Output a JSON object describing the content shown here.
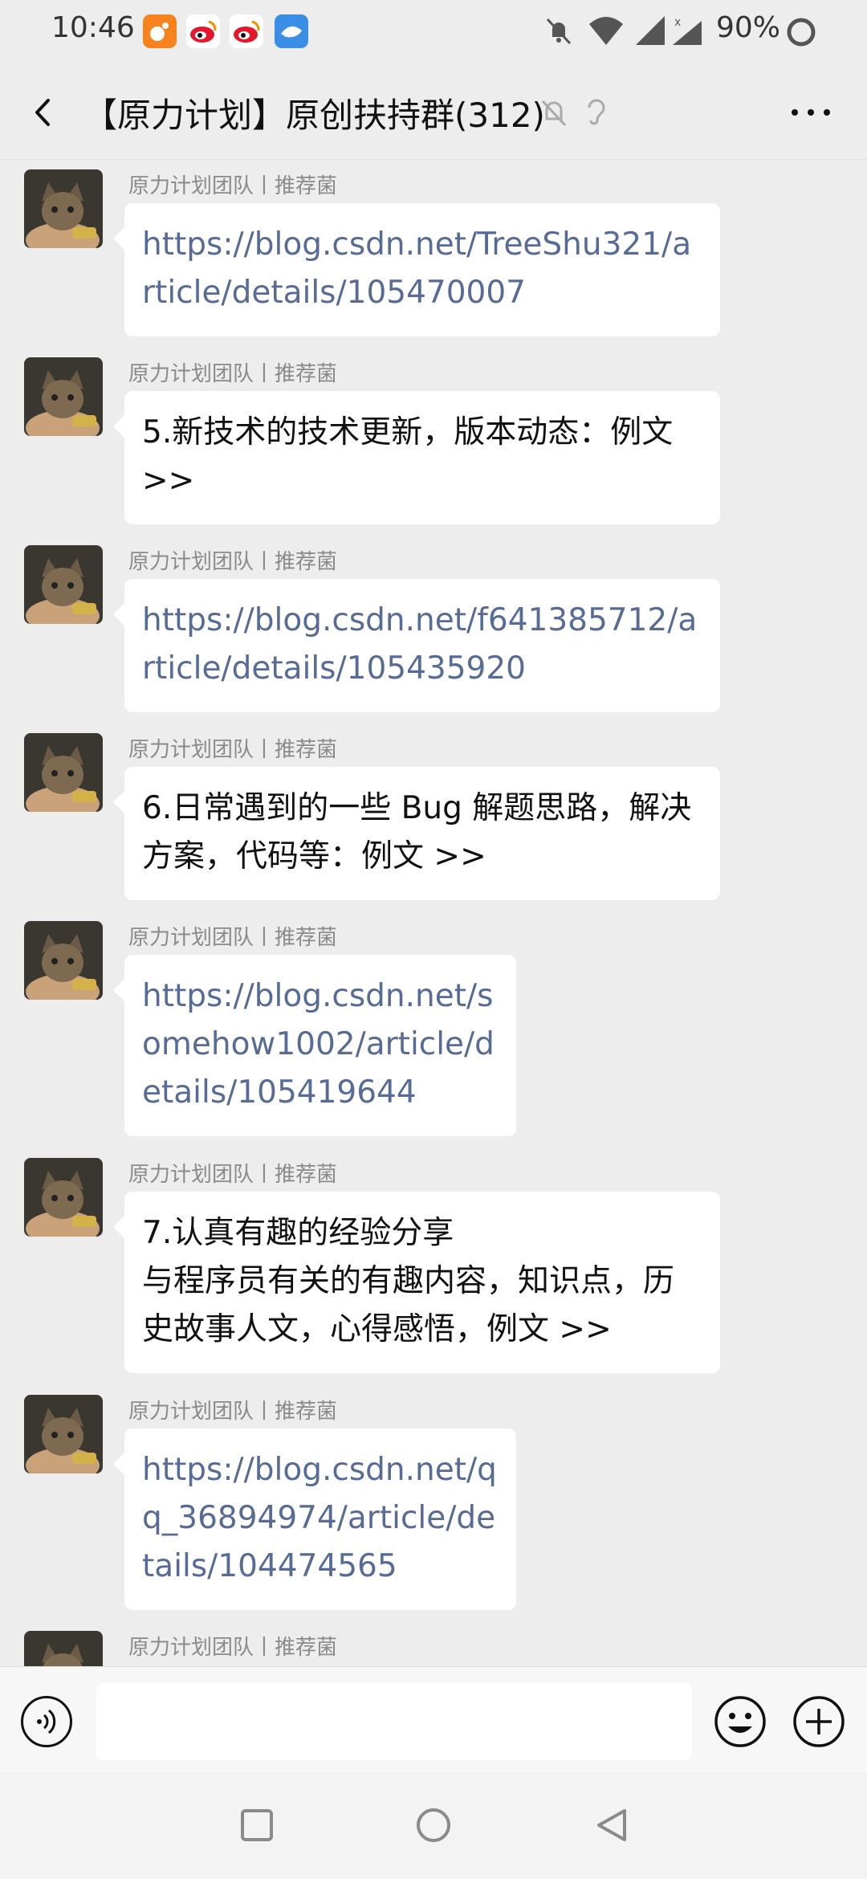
{
  "status_bar": {
    "time": "10:46",
    "battery": "90%",
    "icons": [
      "weibo-orange-icon",
      "weibo-red-icon",
      "weibo-red-icon",
      "app-blue-icon",
      "mute-icon",
      "wifi-icon",
      "signal-icon",
      "signal-x-icon",
      "battery-ring-icon"
    ]
  },
  "header": {
    "title": "【原力计划】原创扶持群(312)",
    "back_icon": "chevron-left-icon",
    "more_icon": "more-dots-icon"
  },
  "messages": [
    {
      "sender": "原力计划团队丨推荐菌",
      "text": "https://blog.csdn.net/TreeShu321/article/details/105470007",
      "is_link": true
    },
    {
      "sender": "原力计划团队丨推荐菌",
      "text": "5.新技术的技术更新，版本动态：例文 >>",
      "is_link": false
    },
    {
      "sender": "原力计划团队丨推荐菌",
      "text": "https://blog.csdn.net/f641385712/article/details/105435920",
      "is_link": true
    },
    {
      "sender": "原力计划团队丨推荐菌",
      "text": "6.日常遇到的一些 Bug 解题思路，解决方案，代码等：例文 >>",
      "is_link": false
    },
    {
      "sender": "原力计划团队丨推荐菌",
      "text": "https://blog.csdn.net/somehow1002/article/details/105419644",
      "is_link": true
    },
    {
      "sender": "原力计划团队丨推荐菌",
      "text": "7.认真有趣的经验分享\n与程序员有关的有趣内容，知识点，历史故事人文，心得感悟，例文 >>",
      "is_link": false
    },
    {
      "sender": "原力计划团队丨推荐菌",
      "text": "https://blog.csdn.net/qq_36894974/article/details/104474565",
      "is_link": true
    },
    {
      "sender": "原力计划团队丨推荐菌",
      "text": "",
      "is_link": false
    }
  ],
  "input_bar": {
    "voice_icon": "voice-icon",
    "emoji_icon": "emoji-icon",
    "plus_icon": "plus-icon"
  },
  "nav_bar": {
    "icons": [
      "recents-square-icon",
      "home-circle-icon",
      "back-triangle-icon"
    ]
  },
  "colors": {
    "background": "#ededed",
    "bubble": "#ffffff",
    "link": "#576b95",
    "sender": "#8a8a8a"
  }
}
